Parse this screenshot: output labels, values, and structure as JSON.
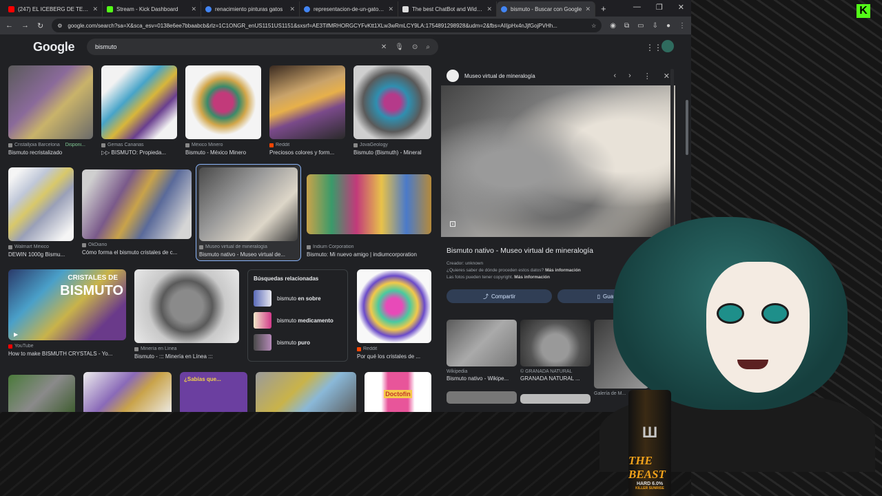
{
  "browser": {
    "tabs": [
      {
        "title": "(247) EL ICEBERG DE TEORÍAS",
        "color": "#ff0000",
        "active": false
      },
      {
        "title": "Stream - Kick Dashboard",
        "color": "#53fc18",
        "active": false
      },
      {
        "title": "renacimiento pinturas gatos",
        "color": "#4285f4",
        "active": false
      },
      {
        "title": "representacion-de-un-gato-en",
        "color": "#4285f4",
        "active": false
      },
      {
        "title": "The best ChatBot and Widgets",
        "color": "#dddddd",
        "active": false
      },
      {
        "title": "bismuto - Buscar con Google",
        "color": "#4285f4",
        "active": true
      }
    ],
    "new_tab": "+",
    "url": "google.com/search?sa=X&sca_esv=0138e6ee7bbaabcb&rlz=1C1ONGR_enUS1151US1151&sxsrf=AE3TifMRHORGCYFvKtt1XLw3wRmLCY9LA:1754891298928&udm=2&fbs=AIIjpHx4nJjfGojPVHh..."
  },
  "google": {
    "logo": "Google",
    "query": "bismuto"
  },
  "results": [
    {
      "source": "Cristalljoia Barcelona",
      "extra": "Disponi...",
      "caption": "Bismuto recristalizado"
    },
    {
      "source": "Gemas Canarias",
      "caption": "▷▷ BISMUTO: Propieda..."
    },
    {
      "source": "México Minero",
      "caption": "Bismuto - México Minero"
    },
    {
      "source": "Reddit",
      "caption": "Preciosos colores y form..."
    },
    {
      "source": "JovaGeology",
      "caption": "Bismuto (Bismuth) - Mineral"
    },
    {
      "source": "Walmart México",
      "caption": "DEWIN 1000g Bismu..."
    },
    {
      "source": "OkDiario",
      "caption": "Cómo forma el bismuto cristales de c..."
    },
    {
      "source": "Museo virtual de mineralogía",
      "caption": "Bismuto nativo - Museo virtual de..."
    },
    {
      "source": "Indium Corporation",
      "caption": "Bismuto: Mi nuevo amigo | indiumcorporation"
    },
    {
      "source": "YouTube",
      "caption": "How to make BISMUTH CRYSTALS - Yo...",
      "overlay": "CRISTALES DE",
      "overlay2": "BISMUTO"
    },
    {
      "source": "Minería en Línea",
      "caption": "Bismuto - ::: Minería en Línea :::"
    },
    {
      "source": "Reddit",
      "caption": "Por qué los cristales de ..."
    }
  ],
  "related": {
    "heading": "Búsquedas relacionadas",
    "items": [
      {
        "prefix": "bismuto",
        "bold": "en sobre"
      },
      {
        "prefix": "bismuto",
        "bold": "medicamento"
      },
      {
        "prefix": "bismuto",
        "bold": "puro"
      }
    ]
  },
  "bottom_row": {
    "promo": "¿Sabías que...",
    "product": "Doctofin"
  },
  "panel": {
    "site": "Museo virtual de mineralogía",
    "title": "Bismuto nativo - Museo virtual de mineralogía",
    "creator": "Creador: unknown",
    "data_q": "¿Quieres saber de dónde proceden estos datos?",
    "data_link": "Más información",
    "copyright": "Las fotos pueden tener copyright.",
    "copyright_link": "Más información",
    "share_label": "Compartir",
    "save_label": "Guardar",
    "thumbs": [
      {
        "source": "Wikipedia",
        "caption": "Bismuto nativo - Wikipe..."
      },
      {
        "source": "© GRANADA NATURAL",
        "caption": "GRANADA NATURAL ..."
      },
      {
        "source": "Galería de M...",
        "caption": "Galería de Mi..."
      }
    ]
  },
  "overlay": {
    "kick": "K",
    "can_brand": "THE BEAST",
    "can_line": "HARD 6.0%",
    "can_flavor": "KILLER SUNRISE"
  }
}
